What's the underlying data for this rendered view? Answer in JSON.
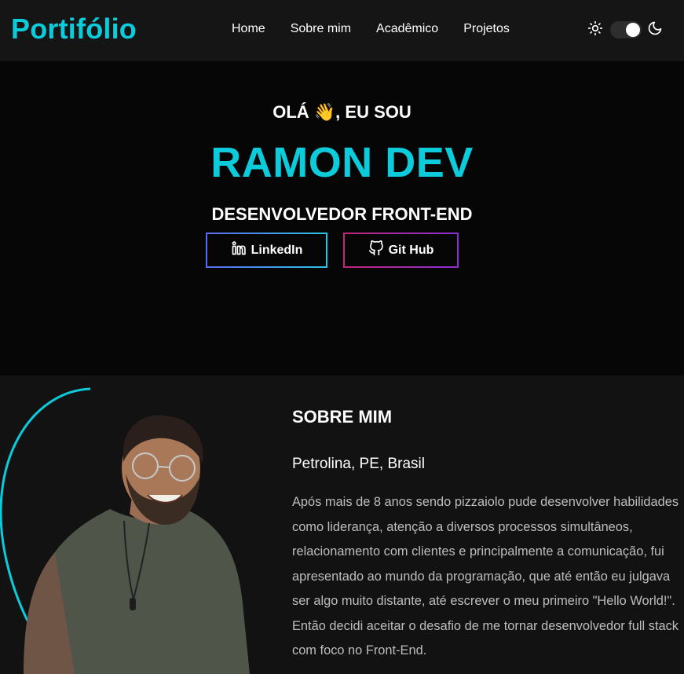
{
  "navbar": {
    "brand": "Portifólio",
    "links": [
      "Home",
      "Sobre mim",
      "Acadêmico",
      "Projetos"
    ],
    "theme_icons": [
      "sun-icon",
      "moon-icon"
    ],
    "theme_mode": "dark"
  },
  "hero": {
    "greeting": "OLÁ 👋, EU SOU",
    "name": "RAMON DEV",
    "role": "DESENVOLVEDOR FRONT-END",
    "buttons": {
      "linkedin": {
        "label": "LinkedIn",
        "icon": "linkedin-icon"
      },
      "github": {
        "label": "Git Hub",
        "icon": "github-icon"
      }
    }
  },
  "about": {
    "title": "SOBRE MIM",
    "location": "Petrolina, PE, Brasil",
    "bio": "Após mais de 8 anos sendo pizzaiolo pude desenvolver habilidades como liderança, atenção a diversos processos simultâneos, relacionamento com clientes e principalmente a comunicação, fui apresentado ao mundo da programação, que até então eu julgava ser algo muito distante, até escrever o meu primeiro \"Hello World!\". Então decidi aceitar o desafio de me tornar desenvolvedor full stack com foco no Front-End."
  },
  "colors": {
    "accent": "#0ccbdb",
    "background": "#121212",
    "hero_background": "#060606",
    "navbar_background": "#151515",
    "text_muted": "#bdbdbd"
  }
}
